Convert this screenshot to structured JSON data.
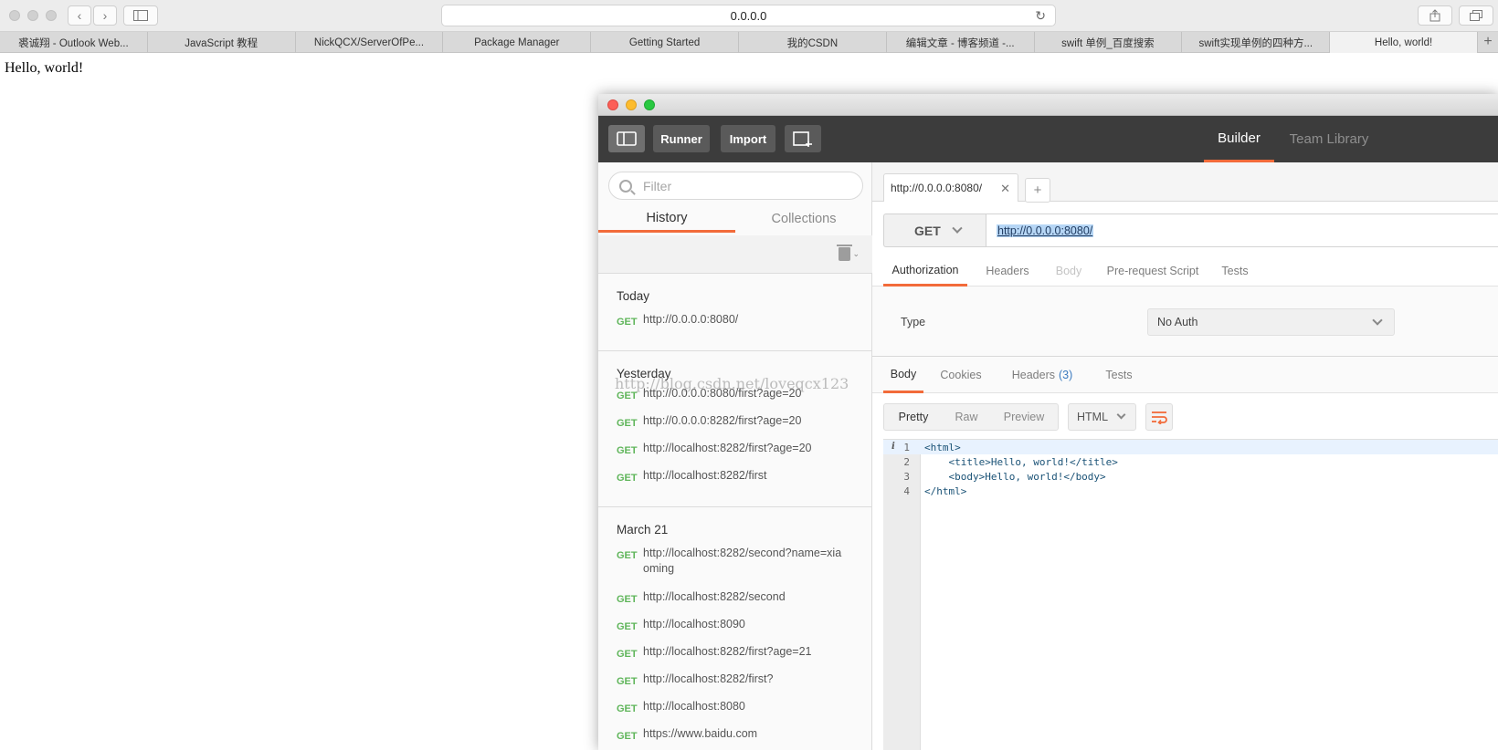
{
  "browser": {
    "address": "0.0.0.0",
    "tabs": [
      "裘诚翔 - Outlook Web...",
      "JavaScript 教程",
      "NickQCX/ServerOfPe...",
      "Package Manager",
      "Getting Started",
      "我的CSDN",
      "编辑文章 - 博客频道 -...",
      "swift 单例_百度搜索",
      "swift实现单例的四种方...",
      "Hello, world!"
    ],
    "page_text": "Hello, world!"
  },
  "postman": {
    "header": {
      "runner": "Runner",
      "import": "Import",
      "builder": "Builder",
      "team_library": "Team Library"
    },
    "sidebar": {
      "filter_placeholder": "Filter",
      "tabs": [
        "History",
        "Collections"
      ],
      "groups": [
        {
          "title": "Today",
          "items": [
            {
              "method": "GET",
              "url": "http://0.0.0.0:8080/"
            }
          ]
        },
        {
          "title": "Yesterday",
          "items": [
            {
              "method": "GET",
              "url": "http://0.0.0.0:8080/first?age=20"
            },
            {
              "method": "GET",
              "url": "http://0.0.0.0:8282/first?age=20"
            },
            {
              "method": "GET",
              "url": "http://localhost:8282/first?age=20"
            },
            {
              "method": "GET",
              "url": "http://localhost:8282/first"
            }
          ]
        },
        {
          "title": "March 21",
          "items": [
            {
              "method": "GET",
              "url": "http://localhost:8282/second?name=xiaoming"
            },
            {
              "method": "GET",
              "url": "http://localhost:8282/second"
            },
            {
              "method": "GET",
              "url": "http://localhost:8090"
            },
            {
              "method": "GET",
              "url": "http://localhost:8282/first?age=21"
            },
            {
              "method": "GET",
              "url": "http://localhost:8282/first?"
            },
            {
              "method": "GET",
              "url": "http://localhost:8080"
            },
            {
              "method": "GET",
              "url": "https://www.baidu.com"
            }
          ]
        }
      ]
    },
    "request": {
      "tab_label": "http://0.0.0.0:8080/",
      "method": "GET",
      "url": "http://0.0.0.0:8080/",
      "sub_tabs": [
        "Authorization",
        "Headers",
        "Body",
        "Pre-request Script",
        "Tests"
      ],
      "auth_type_label": "Type",
      "auth_type_value": "No Auth"
    },
    "response": {
      "tabs": [
        "Body",
        "Cookies",
        "Headers",
        "Tests"
      ],
      "headers_count": "(3)",
      "formats": [
        "Pretty",
        "Raw",
        "Preview"
      ],
      "language": "HTML",
      "code": [
        {
          "no": "1",
          "text": "<html>"
        },
        {
          "no": "2",
          "text": "    <title>Hello, world!</title>"
        },
        {
          "no": "3",
          "text": "    <body>Hello, world!</body>"
        },
        {
          "no": "4",
          "text": "</html>"
        }
      ]
    },
    "watermark": "http://blog.csdn.net/loveqcx123"
  },
  "colors": {
    "accent": "#f26b3a",
    "get_method": "#5fb55a",
    "header_bg": "#3c3c3c"
  }
}
